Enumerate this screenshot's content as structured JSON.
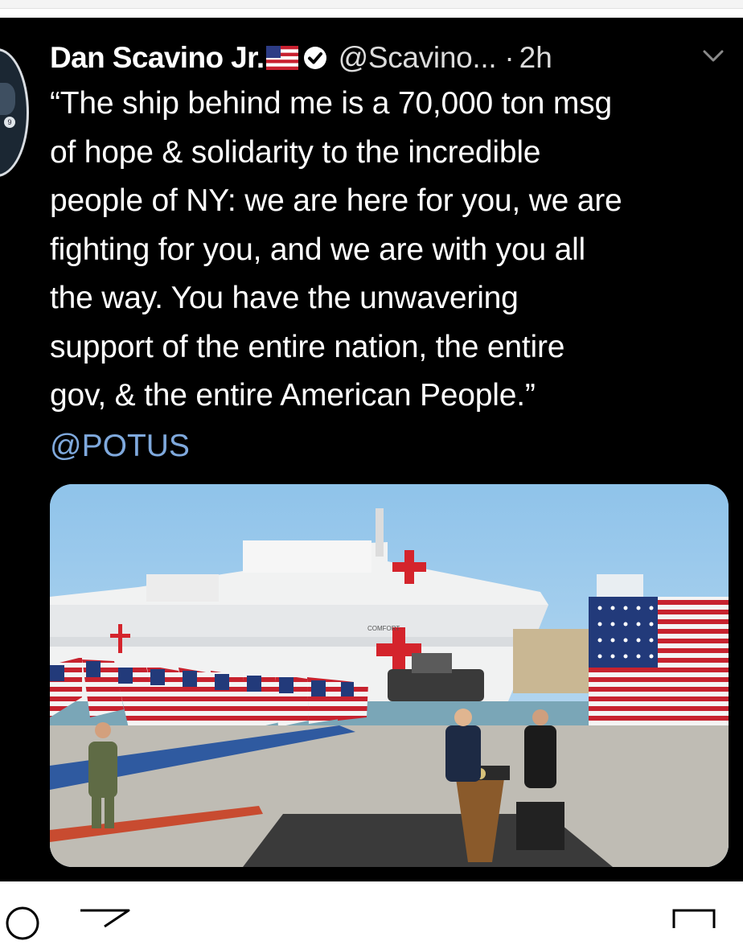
{
  "tweet": {
    "author_name": "Dan Scavino Jr.",
    "author_handle": "@Scavino...",
    "separator": "·",
    "time_ago": "2h",
    "text": "“The ship behind me is a 70,000 ton msg\nof hope & solidarity to the incredible\npeople of NY: we are here for you, we are\nfighting for you, and we are with you all\nthe way. You have the unwavering\nsupport of the entire nation, the entire\ngov, & the entire American People.”",
    "mention": "@POTUS",
    "media": {
      "ship_name": "COMFORT"
    }
  },
  "icons": {
    "flag": "us-flag-icon",
    "verified": "verified-badge-icon",
    "menu": "chevron-down-icon",
    "comment": "comment-icon",
    "share": "send-icon",
    "save": "bookmark-icon"
  },
  "colors": {
    "background": "#000000",
    "text": "#ffffff",
    "mention": "#7fa9dd"
  }
}
